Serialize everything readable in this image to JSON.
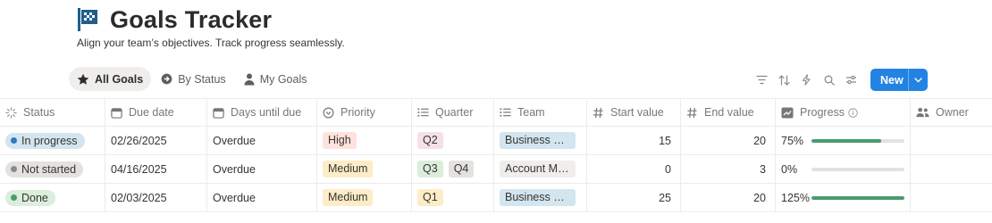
{
  "page": {
    "title": "Goals Tracker",
    "subtitle": "Align your team’s objectives. Track progress seamlessly."
  },
  "views": [
    {
      "label": "All Goals",
      "icon": "star-icon",
      "active": true
    },
    {
      "label": "By Status",
      "icon": "arrow-circle-icon",
      "active": false
    },
    {
      "label": "My Goals",
      "icon": "person-icon",
      "active": false
    }
  ],
  "toolbar": {
    "new_label": "New",
    "tools": [
      "filter-icon",
      "sort-icon",
      "lightning-icon",
      "search-icon",
      "settings-sliders-icon"
    ],
    "accent": "#2383e2"
  },
  "columns": {
    "status": "Status",
    "due": "Due date",
    "days": "Days until due",
    "priority": "Priority",
    "quarter": "Quarter",
    "team": "Team",
    "start": "Start value",
    "end": "End value",
    "progress": "Progress",
    "owner": "Owner"
  },
  "rows": [
    {
      "status": "In progress",
      "status_bg": "#d3e5ef",
      "status_dot": "#2e7bbf",
      "due": "02/26/2025",
      "days": "Overdue",
      "priority": "High",
      "priority_bg": "#ffe2dd",
      "quarters": [
        {
          "label": "Q2",
          "bg": "#f5e0e9"
        }
      ],
      "team": "Business Dev...",
      "team_bg": "#d3e5ef",
      "start": "15",
      "end": "20",
      "progress": "75%",
      "progress_value": 0.75
    },
    {
      "status": "Not started",
      "status_bg": "#e3e2e0",
      "status_dot": "#8b8a87",
      "due": "04/16/2025",
      "days": "Overdue",
      "priority": "Medium",
      "priority_bg": "#fdecc8",
      "quarters": [
        {
          "label": "Q3",
          "bg": "#dbeddb"
        },
        {
          "label": "Q4",
          "bg": "#e3e2e0"
        }
      ],
      "team": "Account Ma...",
      "team_bg": "#efeeec",
      "start": "0",
      "end": "3",
      "progress": "0%",
      "progress_value": 0
    },
    {
      "status": "Done",
      "status_bg": "#dbeddb",
      "status_dot": "#4b9b6e",
      "due": "02/03/2025",
      "days": "Overdue",
      "priority": "Medium",
      "priority_bg": "#fdecc8",
      "quarters": [
        {
          "label": "Q1",
          "bg": "#fdecc8"
        }
      ],
      "team": "Business Dev...",
      "team_bg": "#d3e5ef",
      "start": "25",
      "end": "20",
      "progress": "125%",
      "progress_value": 1.0
    }
  ]
}
